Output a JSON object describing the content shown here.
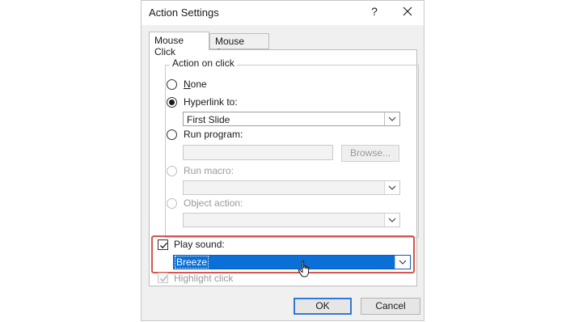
{
  "dialog": {
    "title": "Action Settings",
    "help_glyph": "?",
    "close_icon": "close-icon"
  },
  "tabs": [
    {
      "label": "Mouse Click",
      "active": true
    },
    {
      "label": "Mouse Over",
      "active": false
    }
  ],
  "action_group": {
    "label": "Action on click",
    "options": {
      "none": {
        "label": "None",
        "selected": false,
        "enabled": true
      },
      "hyperlink": {
        "label": "Hyperlink to:",
        "selected": true,
        "enabled": true,
        "value": "First Slide"
      },
      "run_program": {
        "label": "Run program:",
        "selected": false,
        "enabled": true,
        "value": "",
        "browse_label": "Browse..."
      },
      "run_macro": {
        "label": "Run macro:",
        "selected": false,
        "enabled": false,
        "value": ""
      },
      "object_action": {
        "label": "Object action:",
        "selected": false,
        "enabled": false,
        "value": ""
      }
    }
  },
  "play_sound": {
    "label": "Play sound:",
    "checked": true,
    "value": "Breeze"
  },
  "highlight_click": {
    "label": "Highlight click",
    "checked": true,
    "enabled": false
  },
  "buttons": {
    "ok": "OK",
    "cancel": "Cancel"
  },
  "colors": {
    "selection": "#0a6fd6",
    "callout": "#d9534f",
    "ok_border": "#2f79d6"
  },
  "cursor_icon": "hand-pointer-icon"
}
